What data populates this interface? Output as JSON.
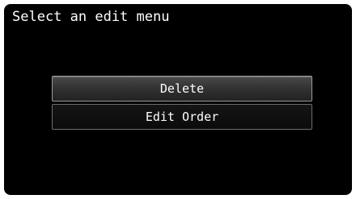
{
  "header": {
    "title": "Select an edit menu"
  },
  "menu": {
    "items": [
      {
        "label": "Delete",
        "selected": true
      },
      {
        "label": "Edit Order",
        "selected": false
      }
    ]
  },
  "colors": {
    "background": "#000000",
    "text": "#ffffff",
    "border": "#6e6e6e",
    "highlight": "#333333"
  }
}
